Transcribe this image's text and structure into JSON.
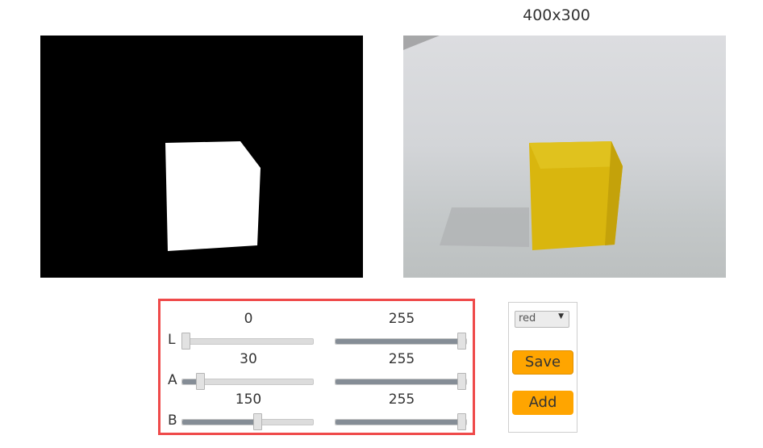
{
  "resolution_label": "400x300",
  "sliders": [
    {
      "label": "L",
      "min_value": "0",
      "max_value": "255",
      "min_level": 0,
      "max_level": 255
    },
    {
      "label": "A",
      "min_value": "30",
      "max_value": "255",
      "min_level": 30,
      "max_level": 255
    },
    {
      "label": "B",
      "min_value": "150",
      "max_value": "255",
      "min_level": 150,
      "max_level": 255
    }
  ],
  "slider_range": [
    0,
    255
  ],
  "controls": {
    "color_select_value": "red",
    "save_label": "Save",
    "add_label": "Add"
  },
  "colors": {
    "panel_border": "#ef4a4a",
    "button_bg": "#ffa500",
    "track_fill": "#858d96",
    "block_yellow": "#d9b60e"
  }
}
